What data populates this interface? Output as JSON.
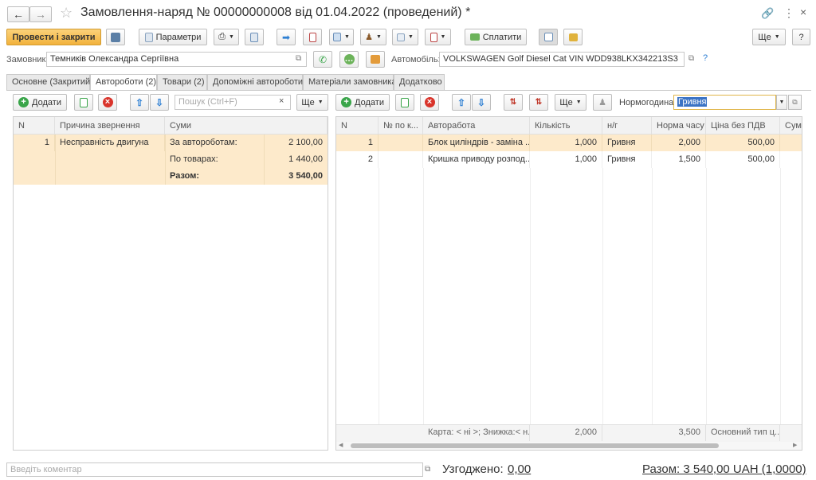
{
  "window": {
    "title": "Замовлення-наряд № 00000000008 від 01.04.2022 (проведений) *",
    "back_icon": "arrow-left-icon",
    "forward_icon": "arrow-right-icon",
    "star_icon": "star-icon",
    "link_icon": "link-icon",
    "more_icon": "more-vert-icon",
    "close_icon": "close-icon"
  },
  "toolbar": {
    "post_close_label": "Провести і закрити",
    "params_label": "Параметри",
    "pay_label": "Сплатити",
    "more_label": "Ще",
    "help_label": "?"
  },
  "header": {
    "customer_label": "Замовник:",
    "customer_value": "Темників Олександра Сергіївна",
    "car_label": "Автомобіль:",
    "car_value": "VOLKSWAGEN Golf Diesel Cat VIN WDD938LKX342213S3",
    "help": "?"
  },
  "tabs": [
    {
      "label": "Основне (Закритий)"
    },
    {
      "label": "Автороботи (2)"
    },
    {
      "label": "Товари (2)"
    },
    {
      "label": "Допоміжні автороботи"
    },
    {
      "label": "Матеріали замовника"
    },
    {
      "label": "Додатково"
    }
  ],
  "left": {
    "add_label": "Додати",
    "search_placeholder": "Пошук (Ctrl+F)",
    "more_label": "Ще",
    "columns": [
      "N",
      "Причина звернення",
      "Суми"
    ],
    "row": {
      "n": "1",
      "reason": "Несправність двигуна"
    },
    "sums": [
      {
        "label": "За автороботам:",
        "value": "2 100,00"
      },
      {
        "label": "По товарах:",
        "value": "1 440,00"
      },
      {
        "label": "Разом:",
        "value": "3 540,00"
      }
    ]
  },
  "right": {
    "add_label": "Додати",
    "more_label": "Ще",
    "norm_label": "Нормогодина:",
    "norm_value": "Гривня",
    "columns": [
      "N",
      "№ по к...",
      "Авторабота",
      "Кількість",
      "н/г",
      "Норма часу",
      "Ціна без ПДВ",
      "Сума"
    ],
    "rows": [
      {
        "n": "1",
        "num": "",
        "work": "Блок циліндрів - заміна ...",
        "qty": "1,000",
        "ng": "Гривня",
        "norm": "2,000",
        "price": "500,00",
        "sum": ""
      },
      {
        "n": "2",
        "num": "",
        "work": "Кришка приводу розпод...",
        "qty": "1,000",
        "ng": "Гривня",
        "norm": "1,500",
        "price": "500,00",
        "sum": ""
      }
    ],
    "footer": {
      "card": "Карта: < ні >; Знижка:< н...",
      "qty": "2,000",
      "norm": "3,500",
      "price": "Основний тип ц..."
    }
  },
  "bottom": {
    "comment_placeholder": "Введіть коментар",
    "agreed_label": "Узгоджено:",
    "agreed_value": "0,00",
    "total": "Разом: 3 540,00 UAH (1,0000)"
  },
  "colors": {
    "primary": "#f2b23c",
    "selected_row": "#fdeacb",
    "add_green": "#3aa54a",
    "delete_red": "#d9342b",
    "arrow_blue": "#2d7fd3"
  }
}
